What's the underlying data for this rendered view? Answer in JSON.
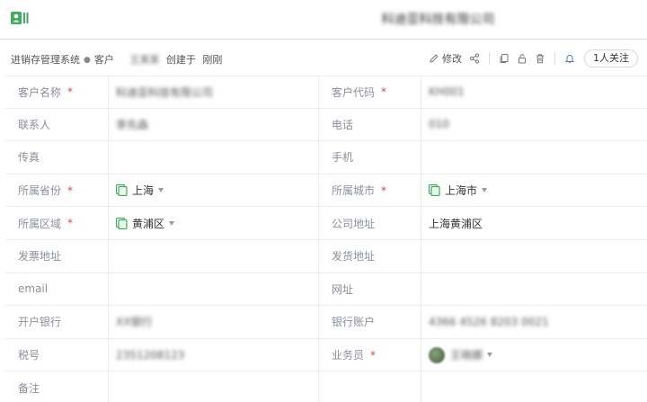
{
  "colors": {
    "accent_green": "#3fae5f",
    "required_red": "#e0474c",
    "label_gray": "#8a8fa0"
  },
  "header": {
    "title": "科迪亚科技有限公司"
  },
  "breadcrumb": {
    "system": "进销存管理系统",
    "module": "客户",
    "creator": "王某某",
    "created_text": "创建于",
    "created_time": "刚刚"
  },
  "actions": {
    "edit_label": "修改",
    "follow_label": "1人关注",
    "icons": [
      "pencil-icon",
      "share-icon",
      "copy-icon",
      "lock-icon",
      "trash-icon",
      "bell-icon"
    ]
  },
  "form": {
    "rows": [
      {
        "l_label": "客户名称",
        "l_req": "*",
        "l_value": "科迪亚科技有限公司",
        "r_label": "客户代码",
        "r_req": "*",
        "r_value": "KH001"
      },
      {
        "l_label": "联系人",
        "l_req": "",
        "l_value": "李先森",
        "r_label": "电话",
        "r_req": "",
        "r_value": "010"
      },
      {
        "l_label": "传真",
        "l_req": "",
        "l_value": "",
        "r_label": "手机",
        "r_req": "",
        "r_value": ""
      },
      {
        "l_label": "所属省份",
        "l_req": "*",
        "l_value": "上海",
        "r_label": "所属城市",
        "r_req": "*",
        "r_value": "上海市"
      },
      {
        "l_label": "所属区域",
        "l_req": "*",
        "l_value": "黄浦区",
        "r_label": "公司地址",
        "r_req": "",
        "r_value": "上海黄浦区"
      },
      {
        "l_label": "发票地址",
        "l_req": "",
        "l_value": "",
        "r_label": "发货地址",
        "r_req": "",
        "r_value": ""
      },
      {
        "l_label": "email",
        "l_req": "",
        "l_value": "",
        "r_label": "网址",
        "r_req": "",
        "r_value": ""
      },
      {
        "l_label": "开户银行",
        "l_req": "",
        "l_value": "XX银行",
        "r_label": "银行账户",
        "r_req": "",
        "r_value": "4366 4526 8203 0021"
      },
      {
        "l_label": "税号",
        "l_req": "",
        "l_value": "2351208123",
        "r_label": "业务员",
        "r_req": "*",
        "r_value": "王晓娜"
      },
      {
        "l_label": "备注",
        "l_req": "",
        "l_value": "",
        "r_label": "",
        "r_req": "",
        "r_value": ""
      }
    ]
  }
}
